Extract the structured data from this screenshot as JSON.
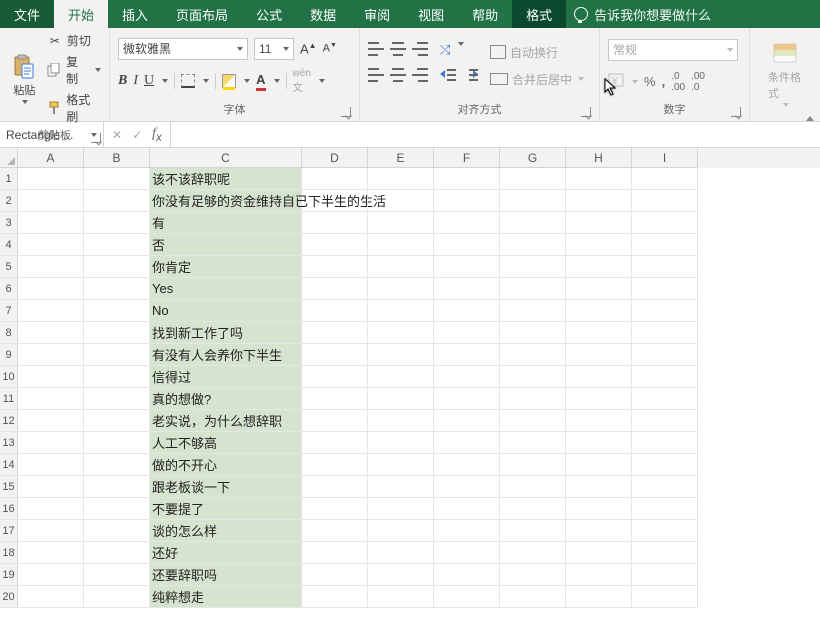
{
  "menu": {
    "file": "文件",
    "home": "开始",
    "insert": "插入",
    "layout": "页面布局",
    "formulas": "公式",
    "data": "数据",
    "review": "审阅",
    "view": "视图",
    "help": "帮助",
    "format": "格式",
    "tellme": "告诉我你想要做什么"
  },
  "ribbon": {
    "clipboard": {
      "paste": "粘贴",
      "cut": "剪切",
      "copy": "复制",
      "painter": "格式刷",
      "label": "剪贴板"
    },
    "font": {
      "name": "微软雅黑",
      "size": "11",
      "wen": "wén",
      "label": "字体"
    },
    "align": {
      "wrap": "自动换行",
      "merge": "合并后居中",
      "label": "对齐方式"
    },
    "number": {
      "format": "常规",
      "label": "数字"
    },
    "cond": {
      "label": "条件格式"
    }
  },
  "fx": {
    "namebox": "Rectangle ..."
  },
  "columns": [
    "A",
    "B",
    "C",
    "D",
    "E",
    "F",
    "G",
    "H",
    "I"
  ],
  "rows_visible": 20,
  "cells": [
    "该不该辞职呢",
    "你没有足够的资金维持自已下半生的生活",
    "有",
    "否",
    "你肯定",
    "Yes",
    "No",
    "找到新工作了吗",
    "有没有人会养你下半生",
    "信得过",
    "真的想做?",
    "老实说，为什么想辞职",
    "人工不够高",
    "做的不开心",
    "跟老板谈一下",
    "不要提了",
    "谈的怎么样",
    "还好",
    "还要辞职吗",
    "纯粹想走"
  ]
}
